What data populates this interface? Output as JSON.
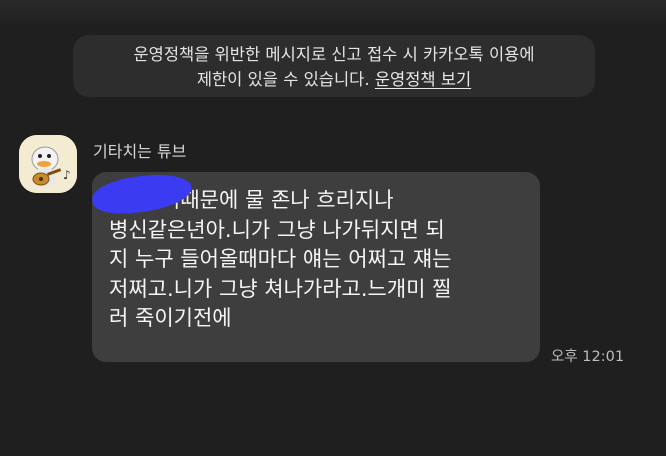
{
  "notice": {
    "line1": "운영정책을 위반한 메시지로 신고 접수 시 카카오톡 이용에",
    "line2_prefix": "제한이 있을 수 있습니다. ",
    "policy_link": "운영정책 보기"
  },
  "message": {
    "sender": "기타치는 튜브",
    "lines": [
      "고 서 니때문에 물 존나 흐리지나",
      "병신같은년아.니가 그냥 나가뒤지면 되",
      "지 누구 들어올때마다 얘는 어쩌고 쟤는",
      "저쩌고.니가 그냥 쳐나가라고.느개미 찔",
      "러 죽이기전에"
    ],
    "time": "오후 12:01"
  },
  "colors": {
    "background": "#1f1f1f",
    "notice_bg": "#2d2d2d",
    "bubble_bg": "#3e3e3e",
    "redaction": "#3b3bf2"
  },
  "icons": {
    "avatar": "tube-duck-guitar-avatar"
  }
}
